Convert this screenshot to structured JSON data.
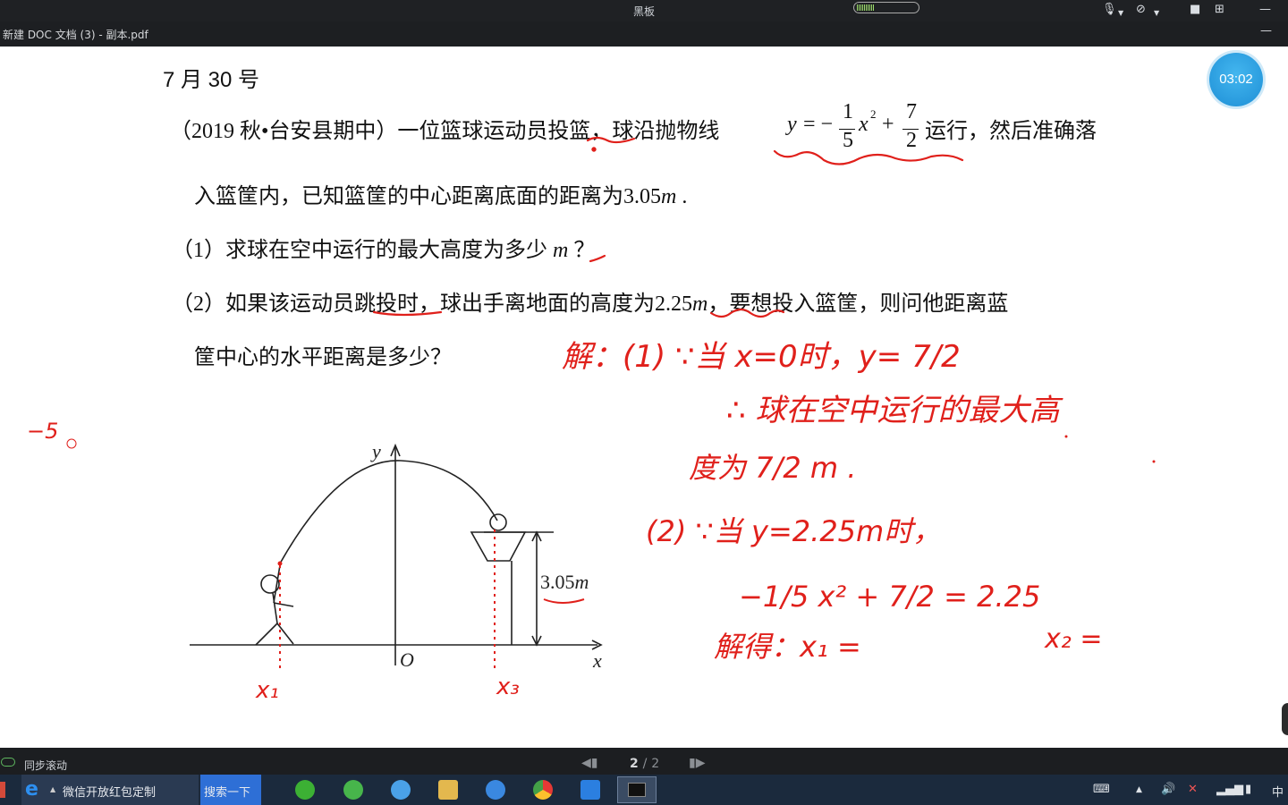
{
  "window": {
    "title": "黑板",
    "doc_name": "新建 DOC 文档 (3) - 副本.pdf",
    "minimize": "—"
  },
  "timer": "03:02",
  "problem": {
    "date": "7 月 30 号",
    "line1_pre": "（2019 秋•台安县期中）一位篮球运动员投篮，球沿抛物线",
    "formula": {
      "y": "y",
      "eq": "= −",
      "n1": "1",
      "d1": "5",
      "x": "x",
      "exp": "2",
      "plus": "+",
      "n2": "7",
      "d2": "2"
    },
    "line1_post": "运行，然后准确落",
    "line2": "入篮筐内，已知篮筐的中心距离底面的距离为",
    "line2_value": "3.05",
    "line2_unit": "m",
    "line2_end": ".",
    "q1_pre": "（1）求球在空中运行的最大高度为多少",
    "q1_unit": "m",
    "q1_end": "？",
    "q2_pre": "（2）如果该运动员跳投时，球出手离地面的高度为",
    "q2_value": "2.25",
    "q2_unit": "m",
    "q2_post": "，要想投入篮筐，则问他距离蓝",
    "q3": "筐中心的水平距离是多少？"
  },
  "figure": {
    "y_axis": "y",
    "x_axis": "x",
    "origin": "O",
    "height_label": "3.05",
    "height_unit": "m"
  },
  "handwriting": {
    "color": "#e0201b",
    "lines": [
      "解：(1) ∵当 x=0时，y= 7/2",
      "∴ 球在空中运行的最大高",
      "度为 7/2 m .",
      "(2) ∵当 y=2.25m时，",
      "−1/5 x² + 7/2 = 2.25",
      "解得：x₁ =",
      "x₂ ="
    ],
    "x1_label": "x₁",
    "x3_label": "x₃",
    "side_mark": "−5"
  },
  "statusbar": {
    "sync_label": "同步滚动",
    "page_current": "2",
    "page_sep": "/",
    "page_total": "2"
  },
  "taskbar": {
    "task_label": "微信开放红包定制",
    "search_label": "搜索一下",
    "ime": "中"
  }
}
